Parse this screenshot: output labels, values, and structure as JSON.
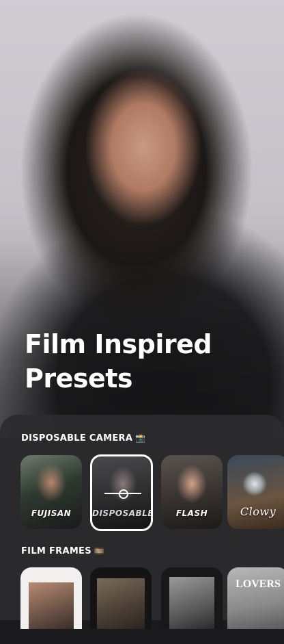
{
  "hero": {
    "headline_line1": "Film Inspired",
    "headline_line2": "Presets"
  },
  "sections": {
    "disposable": {
      "title": "DISPOSABLE CAMERA",
      "emoji": "📸",
      "presets": [
        {
          "label": "FUJISAN"
        },
        {
          "label": "DISPOSABLE",
          "selected": true,
          "icon": "slider-icon"
        },
        {
          "label": "FLASH"
        },
        {
          "label": "Clowy"
        }
      ]
    },
    "frames": {
      "title": "FILM FRAMES",
      "emoji": "🎞️",
      "items": [
        {
          "text": ""
        },
        {
          "text": ""
        },
        {
          "text": ""
        },
        {
          "text": "LOVERS"
        }
      ]
    }
  },
  "colors": {
    "sheet_background": "#2c2c2e",
    "selected_border": "#ffffff",
    "text": "#ffffff"
  }
}
